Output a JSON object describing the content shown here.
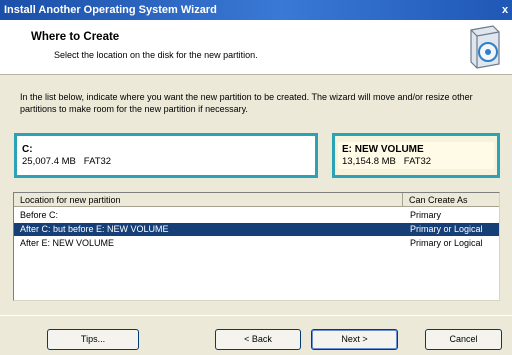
{
  "window": {
    "title": "Install Another Operating System Wizard",
    "close_glyph": "x"
  },
  "header": {
    "title": "Where to Create",
    "subtitle": "Select the location on the disk for the new partition.",
    "icon": "disk-drive-icon"
  },
  "intro_text": "In the list below, indicate where you want the new partition to be created. The wizard will move and/or resize other partitions to make room for the new partition if necessary.",
  "partitions": [
    {
      "name": "C:",
      "info": "25,007.4 MB   FAT32"
    },
    {
      "name": "E:  NEW VOLUME",
      "info": "13,154.8 MB   FAT32"
    }
  ],
  "list": {
    "columns": [
      "Location for new partition",
      "Can Create As"
    ],
    "rows": [
      {
        "location": "Before C:",
        "create_as": "Primary",
        "selected": false
      },
      {
        "location": "After C:  but before E: NEW VOLUME",
        "create_as": "Primary or Logical",
        "selected": true
      },
      {
        "location": "After E: NEW VOLUME",
        "create_as": "Primary or Logical",
        "selected": false
      }
    ]
  },
  "buttons": {
    "tips": "Tips...",
    "back": "< Back",
    "next": "Next >",
    "cancel": "Cancel"
  },
  "colors": {
    "title_bar": "#1b4fa8",
    "partition_border": "#2aa4b4",
    "selection": "#163f78"
  }
}
